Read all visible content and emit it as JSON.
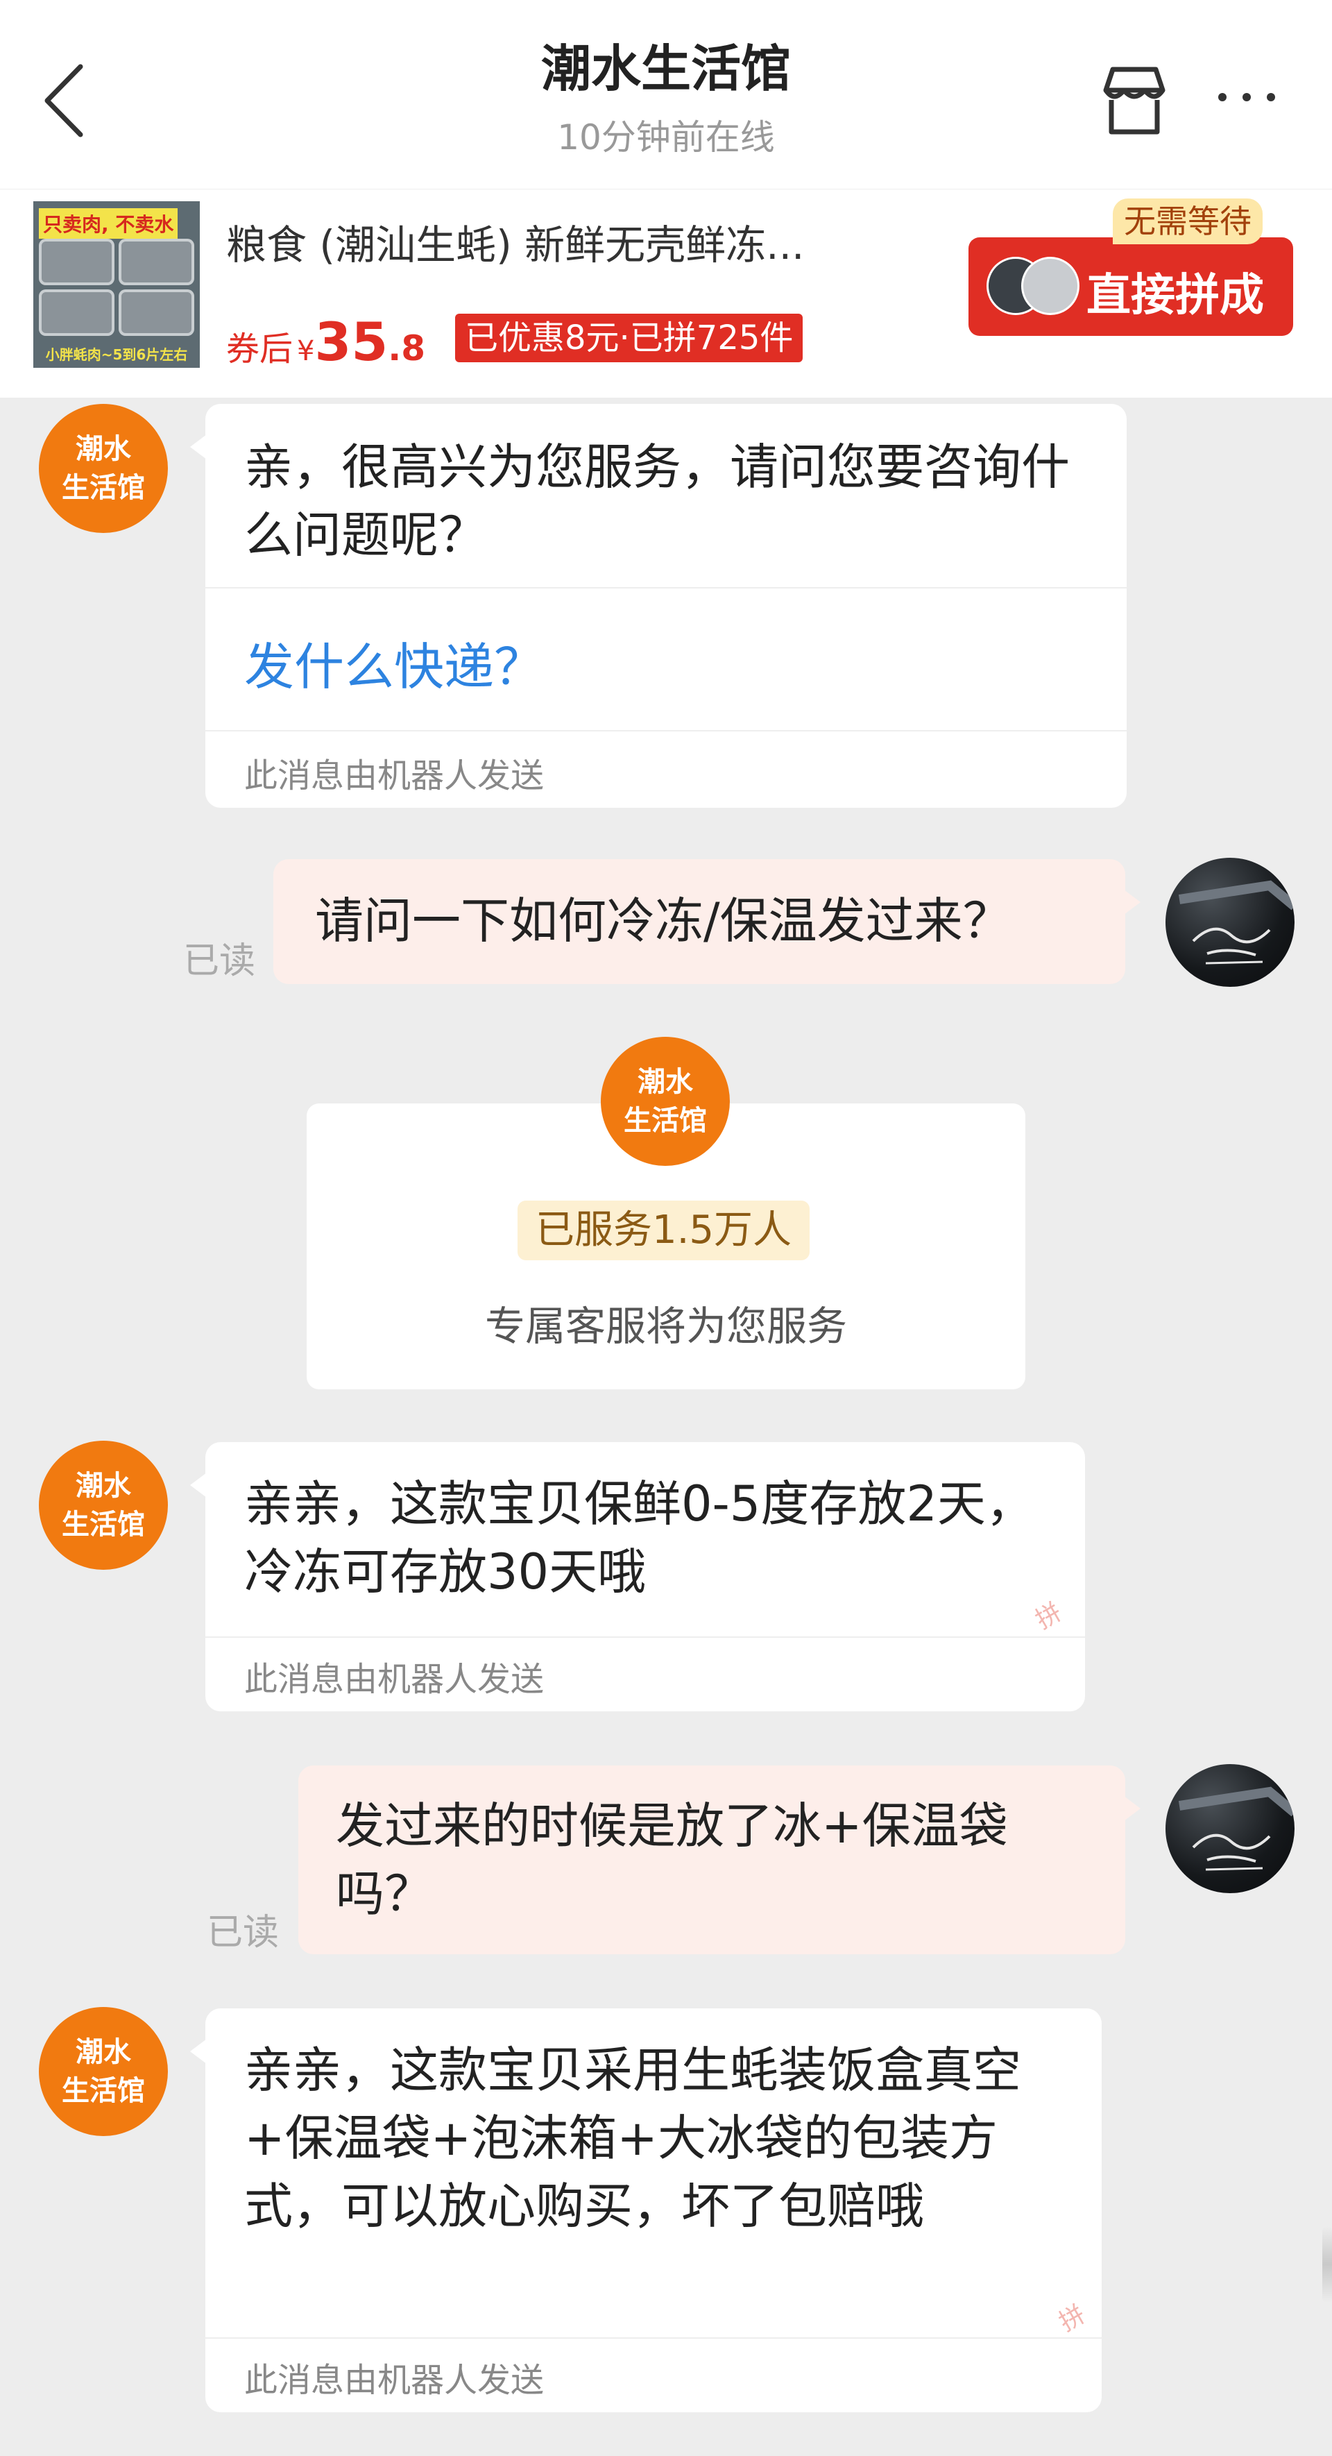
{
  "header": {
    "title": "潮水生活馆",
    "status": "10分钟前在线",
    "icons": {
      "back": "chevron-left-icon",
      "store": "store-icon",
      "more": "more-icon"
    }
  },
  "product": {
    "name": "粮食 (潮汕生蚝) 新鲜无壳鲜冻...",
    "thumb_tag": "只卖肉, 不卖水",
    "thumb_footer": "小胖蚝肉~5到6片左右",
    "price_prefix": "券后",
    "price_currency": "¥",
    "price_integer": "35",
    "price_decimal": ".8",
    "promo_badge": "已优惠8元·已拼725件",
    "no_wait_badge": "无需等待",
    "group_buy_button": "直接拼成"
  },
  "shop_avatar": {
    "line1": "潮水",
    "line2": "生活馆"
  },
  "messages": [
    {
      "sender": "shop",
      "text": "亲，很高兴为您服务，请问您要咨询什么问题呢？",
      "quick_question": "发什么快递？",
      "robot_note": "此消息由机器人发送"
    },
    {
      "sender": "user",
      "text": "请问一下如何冷冻/保温发过来？",
      "read_status": "已读"
    },
    {
      "sender": "shop",
      "text": "亲亲，这款宝贝保鲜0-5度存放2天，冷冻可存放30天哦",
      "robot_note": "此消息由机器人发送"
    },
    {
      "sender": "user",
      "text": "发过来的时候是放了冰+保温袋吗？",
      "read_status": "已读"
    },
    {
      "sender": "shop",
      "text": "亲亲，这款宝贝采用生蚝装饭盒真空+保温袋+泡沫箱+大冰袋的包装方式，可以放心购买，坏了包赔哦",
      "robot_note": "此消息由机器人发送"
    }
  ],
  "service_card": {
    "served_badge": "已服务1.5万人",
    "text": "专属客服将为您服务"
  },
  "watermark": "拼",
  "colors": {
    "accent_red": "#e02e24",
    "shop_orange": "#f17a10",
    "link_blue": "#2d83e0",
    "user_bubble": "#fdeeea",
    "background": "#ededed"
  }
}
